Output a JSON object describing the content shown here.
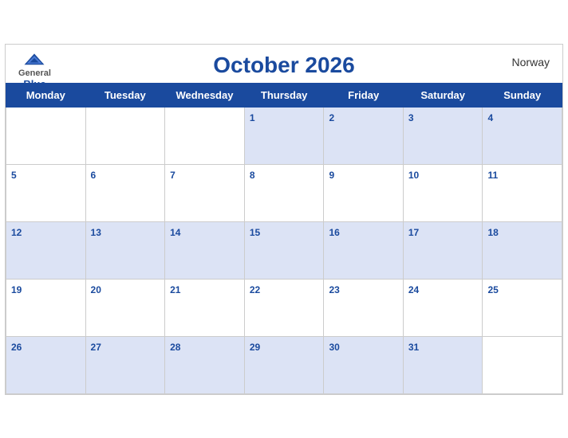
{
  "header": {
    "logo_general": "General",
    "logo_blue": "Blue",
    "month_title": "October 2026",
    "country": "Norway"
  },
  "weekdays": [
    "Monday",
    "Tuesday",
    "Wednesday",
    "Thursday",
    "Friday",
    "Saturday",
    "Sunday"
  ],
  "weeks": [
    [
      null,
      null,
      null,
      1,
      2,
      3,
      4
    ],
    [
      5,
      6,
      7,
      8,
      9,
      10,
      11
    ],
    [
      12,
      13,
      14,
      15,
      16,
      17,
      18
    ],
    [
      19,
      20,
      21,
      22,
      23,
      24,
      25
    ],
    [
      26,
      27,
      28,
      29,
      30,
      31,
      null
    ]
  ],
  "colors": {
    "header_bg": "#1a4a9e",
    "row_odd": "#dce3f5",
    "row_even": "#ffffff",
    "day_num": "#1a4a9e"
  }
}
